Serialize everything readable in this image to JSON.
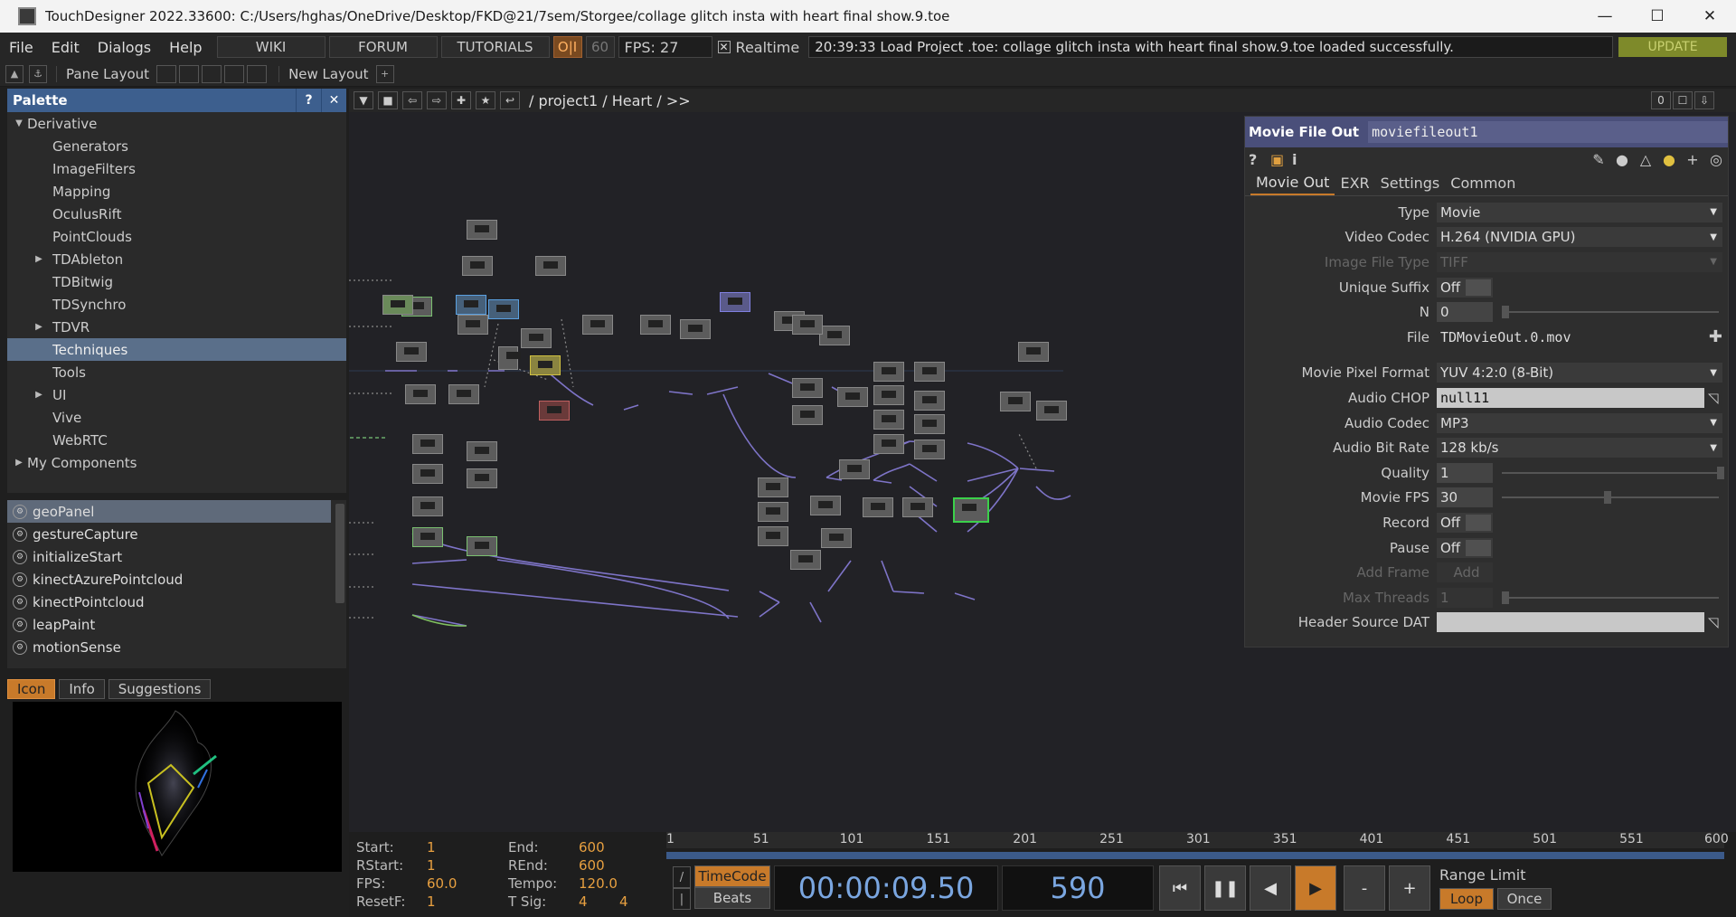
{
  "window": {
    "title": "TouchDesigner 2022.33600: C:/Users/hghas/OneDrive/Desktop/FKD@21/7sem/Storgee/collage glitch insta with heart final show.9.toe"
  },
  "menu": {
    "file": "File",
    "edit": "Edit",
    "dialogs": "Dialogs",
    "help": "Help",
    "wiki": "WIKI",
    "forum": "FORUM",
    "tutorials": "TUTORIALS",
    "oi": "O|I",
    "fps_cap": "60",
    "fps_label": "FPS:",
    "fps_value": "27",
    "realtime_check": "✕",
    "realtime": "Realtime",
    "status": "20:39:33 Load Project .toe: collage glitch insta with heart final show.9.toe loaded successfully.",
    "update": "UPDATE"
  },
  "toolbar": {
    "pane_layout": "Pane Layout",
    "new_layout": "New Layout",
    "plus": "+"
  },
  "palette": {
    "title": "Palette",
    "help": "?",
    "close": "✕",
    "tree": [
      {
        "label": "Derivative",
        "expand": "▼",
        "indent": 0
      },
      {
        "label": "Generators",
        "expand": "",
        "indent": 2
      },
      {
        "label": "ImageFilters",
        "expand": "",
        "indent": 1
      },
      {
        "label": "Mapping",
        "expand": "",
        "indent": 1
      },
      {
        "label": "OculusRift",
        "expand": "",
        "indent": 1
      },
      {
        "label": "PointClouds",
        "expand": "",
        "indent": 1
      },
      {
        "label": "TDAbleton",
        "expand": "▶",
        "indent": 1
      },
      {
        "label": "TDBitwig",
        "expand": "",
        "indent": 1
      },
      {
        "label": "TDSynchro",
        "expand": "",
        "indent": 1
      },
      {
        "label": "TDVR",
        "expand": "▶",
        "indent": 1
      },
      {
        "label": "Techniques",
        "expand": "",
        "indent": 1,
        "selected": true
      },
      {
        "label": "Tools",
        "expand": "",
        "indent": 1
      },
      {
        "label": "UI",
        "expand": "▶",
        "indent": 1
      },
      {
        "label": "Vive",
        "expand": "",
        "indent": 1
      },
      {
        "label": "WebRTC",
        "expand": "",
        "indent": 1
      },
      {
        "label": "My Components",
        "expand": "▶",
        "indent": 0
      }
    ],
    "components": [
      "geoPanel",
      "gestureCapture",
      "initializeStart",
      "kinectAzurePointcloud",
      "kinectPointcloud",
      "leapPaint",
      "motionSense"
    ],
    "tabs": {
      "icon": "Icon",
      "info": "Info",
      "suggestions": "Suggestions"
    }
  },
  "network": {
    "path": "/ project1 / Heart / >>",
    "counter": "0"
  },
  "params": {
    "op_type": "Movie File Out",
    "op_name": "moviefileout1",
    "tabs": [
      "Movie Out",
      "EXR",
      "Settings",
      "Common"
    ],
    "rows": [
      {
        "label": "Type",
        "value": "Movie",
        "kind": "menu"
      },
      {
        "label": "Video Codec",
        "value": "H.264 (NVIDIA GPU)",
        "kind": "menu"
      },
      {
        "label": "Image File Type",
        "value": "TIFF",
        "kind": "menu",
        "disabled": true
      },
      {
        "label": "Unique Suffix",
        "value": "Off",
        "kind": "toggle"
      },
      {
        "label": "N",
        "value": "0",
        "kind": "slider"
      },
      {
        "label": "File",
        "value": "TDMovieOut.0.mov",
        "kind": "file"
      },
      {
        "label": "Movie Pixel Format",
        "value": "YUV 4:2:0 (8-Bit)",
        "kind": "menu"
      },
      {
        "label": "Audio CHOP",
        "value": "null11",
        "kind": "field"
      },
      {
        "label": "Audio Codec",
        "value": "MP3",
        "kind": "menu"
      },
      {
        "label": "Audio Bit Rate",
        "value": "128 kb/s",
        "kind": "menu"
      },
      {
        "label": "Quality",
        "value": "1",
        "kind": "slider"
      },
      {
        "label": "Movie FPS",
        "value": "30",
        "kind": "slider"
      },
      {
        "label": "Record",
        "value": "Off",
        "kind": "toggle"
      },
      {
        "label": "Pause",
        "value": "Off",
        "kind": "toggle"
      },
      {
        "label": "Add Frame",
        "value": "Add",
        "kind": "button",
        "disabled": true
      },
      {
        "label": "Max Threads",
        "value": "1",
        "kind": "slider",
        "disabled": true
      },
      {
        "label": "Header Source DAT",
        "value": "",
        "kind": "field"
      }
    ]
  },
  "timeline": {
    "start_k": "Start:",
    "start_v": "1",
    "end_k": "End:",
    "end_v": "600",
    "rstart_k": "RStart:",
    "rstart_v": "1",
    "rend_k": "REnd:",
    "rend_v": "600",
    "fps_k": "FPS:",
    "fps_v": "60.0",
    "tempo_k": "Tempo:",
    "tempo_v": "120.0",
    "resetf_k": "ResetF:",
    "resetf_v": "1",
    "tsig_k": "T Sig:",
    "tsig_v": "4",
    "tsig_v2": "4",
    "ruler": [
      "1",
      "51",
      "101",
      "151",
      "201",
      "251",
      "301",
      "351",
      "401",
      "451",
      "501",
      "551",
      "600"
    ],
    "timecode": "TimeCode",
    "beats": "Beats",
    "time": "00:00:09.50",
    "frame": "590",
    "range_limit": "Range Limit",
    "loop": "Loop",
    "once": "Once",
    "slash": "/",
    "bar": "|",
    "minus": "-",
    "plus": "+"
  }
}
